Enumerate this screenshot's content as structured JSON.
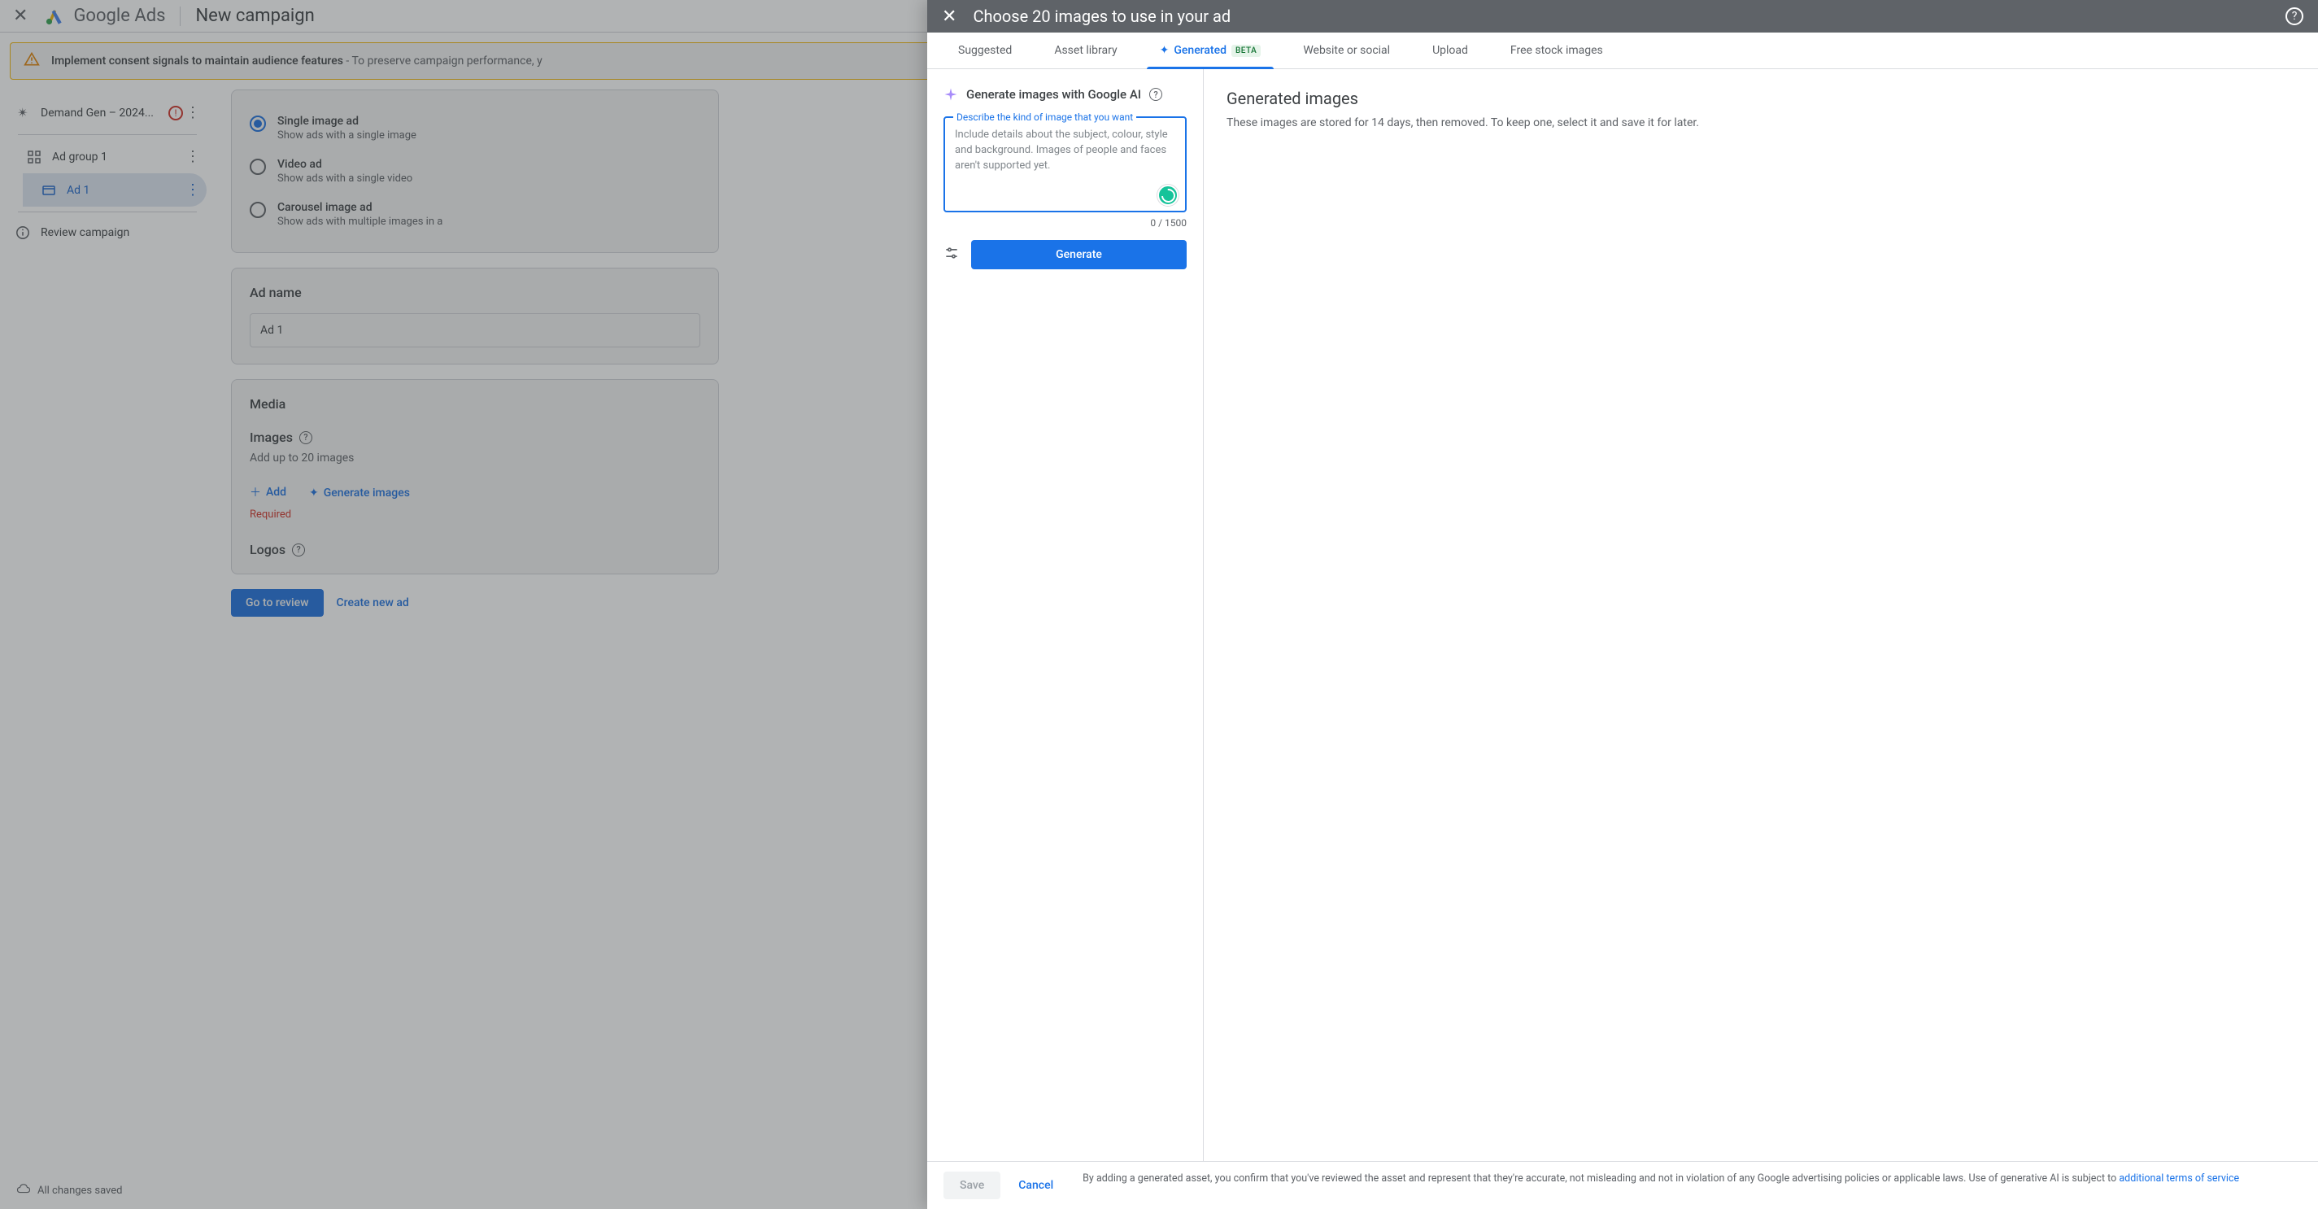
{
  "topbar": {
    "logo_text": "Google Ads",
    "page_title": "New campaign"
  },
  "alert": {
    "bold": "Implement consent signals to maintain audience features",
    "rest": " - To preserve campaign performance, y"
  },
  "sidebar": {
    "campaign_label": "Demand Gen – 2024...",
    "adgroup_label": "Ad group 1",
    "ad_label": "Ad 1",
    "review_label": "Review campaign",
    "saved": "All changes saved"
  },
  "ad_format": {
    "opts": [
      {
        "title": "Single image ad",
        "sub": "Show ads with a single image",
        "selected": true
      },
      {
        "title": "Video ad",
        "sub": "Show ads with a single video",
        "selected": false
      },
      {
        "title": "Carousel image ad",
        "sub": "Show ads with multiple images in a",
        "selected": false
      }
    ]
  },
  "ad_name": {
    "heading": "Ad name",
    "value": "Ad 1"
  },
  "media": {
    "heading": "Media",
    "images_label": "Images",
    "images_hint": "Add up to 20 images",
    "add_label": "Add",
    "gen_label": "Generate images",
    "required": "Required",
    "logos_label": "Logos"
  },
  "bottom": {
    "review": "Go to review",
    "create": "Create new ad"
  },
  "modal": {
    "title": "Choose 20 images to use in your ad",
    "tabs": {
      "suggested": "Suggested",
      "library": "Asset library",
      "generated": "Generated",
      "beta": "BETA",
      "website": "Website or social",
      "upload": "Upload",
      "stock": "Free stock images"
    },
    "gen": {
      "heading": "Generate images with Google AI",
      "prompt_label": "Describe the kind of image that you want",
      "placeholder": "Include details about the subject, colour, style and background. Images of people and faces aren't supported yet.",
      "count": "0 / 1500",
      "button": "Generate"
    },
    "right": {
      "heading": "Generated images",
      "body": "These images are stored for 14 days, then removed. To keep one, select it and save it for later."
    },
    "footer": {
      "save": "Save",
      "cancel": "Cancel",
      "legal": "By adding a generated asset, you confirm that you've reviewed the asset and represent that they're accurate, not misleading and not in violation of any Google advertising policies or applicable laws. Use of generative AI is subject to ",
      "legal_link": "additional terms of service"
    }
  }
}
